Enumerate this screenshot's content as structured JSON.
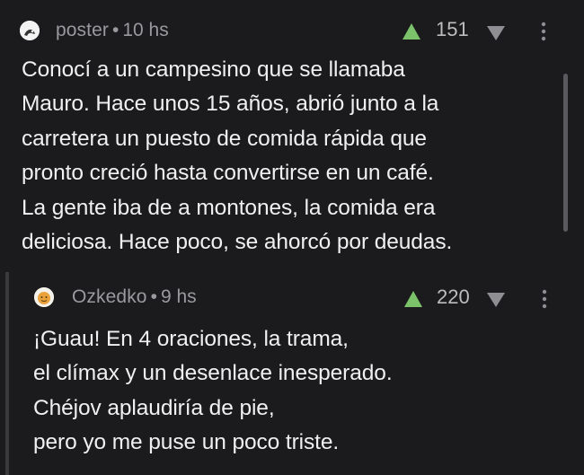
{
  "comments": [
    {
      "user": "poster",
      "separator": "•",
      "time": "10 hs",
      "score": "151",
      "avatar_icon": "poster-avatar-icon",
      "lines": [
        "Conocí a un campesino que se llamaba",
        "Mauro. Hace unos 15 años, abrió junto a la",
        "carretera un puesto de comida rápida que",
        "pronto creció hasta convertirse en un café.",
        "La gente iba de a montones, la comida era",
        "deliciosa. Hace poco, se ahorcó por deudas."
      ]
    },
    {
      "user": "Ozkedko",
      "separator": "•",
      "time": "9 hs",
      "score": "220",
      "avatar_icon": "emoji-face-avatar-icon",
      "lines": [
        "¡Guau! En 4 oraciones, la trama,",
        "el clímax y un desenlace inesperado.",
        "Chéjov aplaudiría de pie,",
        "pero yo me puse un poco triste."
      ]
    }
  ],
  "colors": {
    "background": "#1b1b1d",
    "upvote": "#7cc26a",
    "downvote": "#8e8e93",
    "meta_text": "#9a9a9e",
    "body_text": "#f0f0f0"
  }
}
